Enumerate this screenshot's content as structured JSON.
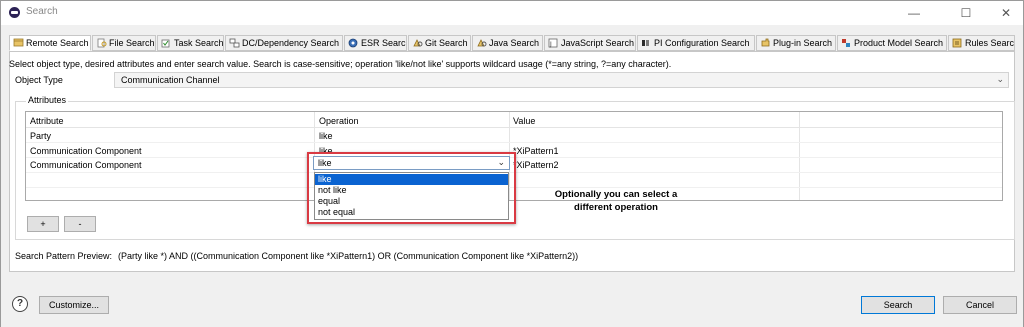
{
  "window": {
    "title": "Search",
    "minimize_glyph": "—",
    "maximize_glyph": "☐",
    "close_glyph": "✕"
  },
  "tabs": [
    {
      "label": "Remote Search",
      "icon": "remote-search-icon",
      "active": true
    },
    {
      "label": "File Search",
      "icon": "file-search-icon"
    },
    {
      "label": "Task Search",
      "icon": "task-search-icon"
    },
    {
      "label": "DC/Dependency Search",
      "icon": "dependency-search-icon"
    },
    {
      "label": "ESR Search",
      "icon": "esr-search-icon"
    },
    {
      "label": "Git Search",
      "icon": "git-search-icon"
    },
    {
      "label": "Java Search",
      "icon": "java-search-icon"
    },
    {
      "label": "JavaScript Search",
      "icon": "javascript-search-icon"
    },
    {
      "label": "PI Configuration Search",
      "icon": "pi-configuration-search-icon"
    },
    {
      "label": "Plug-in Search",
      "icon": "plugin-search-icon"
    },
    {
      "label": "Product Model Search",
      "icon": "product-model-search-icon"
    },
    {
      "label": "Rules Search",
      "icon": "rules-search-icon"
    }
  ],
  "instructions": "Select object type, desired attributes and enter search value. Search is case-sensitive; operation 'like/not like' supports wildcard usage (*=any string, ?=any character).",
  "object_type": {
    "label": "Object Type",
    "value": "Communication Channel",
    "chevron": "⌄"
  },
  "attributes": {
    "group_title": "Attributes",
    "columns": [
      "Attribute",
      "Operation",
      "Value"
    ],
    "rows": [
      {
        "attribute": "Party",
        "operation": "like",
        "value": ""
      },
      {
        "attribute": "Communication Component",
        "operation": "like",
        "value": "*XiPattern1"
      },
      {
        "attribute": "Communication Component",
        "operation": "like",
        "value": "*XiPattern2"
      }
    ],
    "add_button": "+",
    "remove_button": "-"
  },
  "operation_dropdown": {
    "selected": "like",
    "chevron": "⌄",
    "options": [
      "like",
      "not like",
      "equal",
      "not equal"
    ]
  },
  "callout": {
    "line1": "Optionally you can select a",
    "line2": "different operation"
  },
  "preview": {
    "label": "Search Pattern Preview:",
    "value": "(Party like *) AND ((Communication Component like *XiPattern1) OR (Communication Component like *XiPattern2))"
  },
  "footer": {
    "help_glyph": "?",
    "customize": "Customize...",
    "search": "Search",
    "cancel": "Cancel"
  },
  "colors": {
    "selection": "#0a63d1",
    "highlight_border": "#d93a43"
  }
}
